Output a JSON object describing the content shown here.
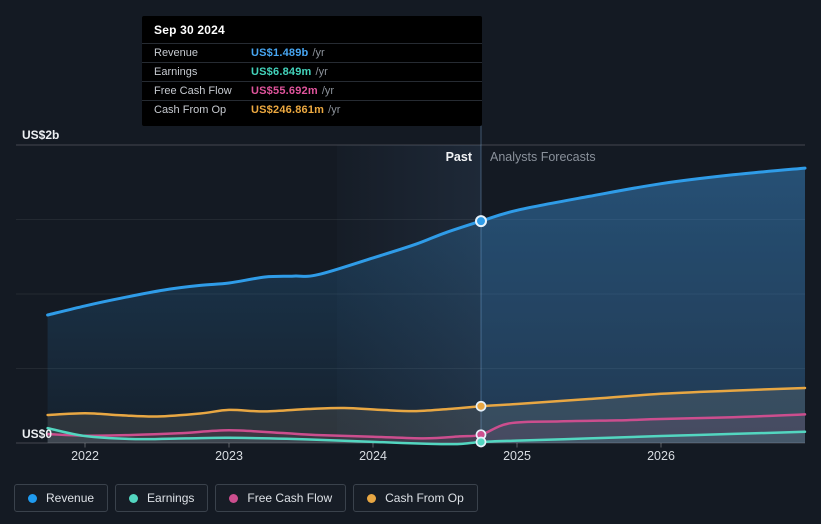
{
  "tooltip": {
    "date": "Sep 30 2024",
    "rows": [
      {
        "label": "Revenue",
        "value": "US$1.489b",
        "suffix": "/yr",
        "color": "#47a6f2"
      },
      {
        "label": "Earnings",
        "value": "US$6.849m",
        "suffix": "/yr",
        "color": "#43d3bb"
      },
      {
        "label": "Free Cash Flow",
        "value": "US$55.692m",
        "suffix": "/yr",
        "color": "#e0549c"
      },
      {
        "label": "Cash From Op",
        "value": "US$246.861m",
        "suffix": "/yr",
        "color": "#eda940"
      }
    ]
  },
  "annotations": {
    "past_label": "Past",
    "forecast_label": "Analysts Forecasts"
  },
  "y_axis": {
    "top_label": "US$2b",
    "bottom_label": "US$0"
  },
  "legend": {
    "items": [
      {
        "label": "Revenue",
        "color": "#1f9bf0"
      },
      {
        "label": "Earnings",
        "color": "#53d6c0"
      },
      {
        "label": "Free Cash Flow",
        "color": "#cc4e8e"
      },
      {
        "label": "Cash From Op",
        "color": "#e8a743"
      }
    ]
  },
  "chart_data": {
    "type": "area",
    "unit": "US$ billions per year",
    "xlim": [
      2021.74,
      2027
    ],
    "ylim": [
      0,
      2
    ],
    "y_gridlines": [
      0,
      0.5,
      1,
      1.5,
      2
    ],
    "x_ticks": [
      2022,
      2023,
      2024,
      2025,
      2026
    ],
    "divider_x": 2024.75,
    "divider_date": "Sep 30 2024",
    "highlight_band": [
      2023.75,
      2024.75
    ],
    "grid": true,
    "legend_position": "bottom",
    "series": [
      {
        "name": "Revenue",
        "color": "#2f9ce8",
        "marker_value": 1.489,
        "points": [
          [
            2021.74,
            0.859
          ],
          [
            2022,
            0.92
          ],
          [
            2022.25,
            0.972
          ],
          [
            2022.55,
            1.027
          ],
          [
            2022.8,
            1.058
          ],
          [
            2023,
            1.074
          ],
          [
            2023.25,
            1.114
          ],
          [
            2023.45,
            1.12
          ],
          [
            2023.62,
            1.13
          ],
          [
            2024,
            1.242
          ],
          [
            2024.3,
            1.335
          ],
          [
            2024.5,
            1.41
          ],
          [
            2024.75,
            1.489
          ],
          [
            2025,
            1.562
          ],
          [
            2025.5,
            1.655
          ],
          [
            2026,
            1.74
          ],
          [
            2026.5,
            1.8
          ],
          [
            2027,
            1.845
          ]
        ]
      },
      {
        "name": "Cash From Op",
        "color": "#e8a743",
        "marker_value": 0.246861,
        "points": [
          [
            2021.74,
            0.188
          ],
          [
            2022,
            0.2
          ],
          [
            2022.25,
            0.186
          ],
          [
            2022.5,
            0.178
          ],
          [
            2022.8,
            0.198
          ],
          [
            2023,
            0.222
          ],
          [
            2023.25,
            0.212
          ],
          [
            2023.55,
            0.228
          ],
          [
            2023.8,
            0.235
          ],
          [
            2024.05,
            0.222
          ],
          [
            2024.3,
            0.214
          ],
          [
            2024.55,
            0.23
          ],
          [
            2024.75,
            0.2469
          ],
          [
            2025,
            0.262
          ],
          [
            2025.5,
            0.295
          ],
          [
            2026,
            0.33
          ],
          [
            2026.5,
            0.352
          ],
          [
            2027,
            0.369
          ]
        ]
      },
      {
        "name": "Free Cash Flow",
        "color": "#cc4e8e",
        "marker_value": 0.055692,
        "points": [
          [
            2021.74,
            0.06
          ],
          [
            2022,
            0.049
          ],
          [
            2022.3,
            0.053
          ],
          [
            2022.65,
            0.065
          ],
          [
            2023,
            0.085
          ],
          [
            2023.35,
            0.068
          ],
          [
            2023.6,
            0.054
          ],
          [
            2024,
            0.042
          ],
          [
            2024.35,
            0.031
          ],
          [
            2024.6,
            0.044
          ],
          [
            2024.75,
            0.0557
          ],
          [
            2024.95,
            0.132
          ],
          [
            2025.3,
            0.145
          ],
          [
            2025.7,
            0.152
          ],
          [
            2026,
            0.161
          ],
          [
            2026.5,
            0.173
          ],
          [
            2027,
            0.192
          ]
        ]
      },
      {
        "name": "Earnings",
        "color": "#53d6c0",
        "marker_value": 0.006849,
        "points": [
          [
            2021.74,
            0.1
          ],
          [
            2022,
            0.047
          ],
          [
            2022.35,
            0.026
          ],
          [
            2022.7,
            0.031
          ],
          [
            2023,
            0.035
          ],
          [
            2023.4,
            0.028
          ],
          [
            2023.8,
            0.015
          ],
          [
            2024.1,
            0.004
          ],
          [
            2024.4,
            -0.006
          ],
          [
            2024.6,
            -0.007
          ],
          [
            2024.75,
            0.0068
          ],
          [
            2025,
            0.016
          ],
          [
            2025.5,
            0.031
          ],
          [
            2026,
            0.047
          ],
          [
            2026.5,
            0.061
          ],
          [
            2027,
            0.075
          ]
        ]
      }
    ]
  }
}
